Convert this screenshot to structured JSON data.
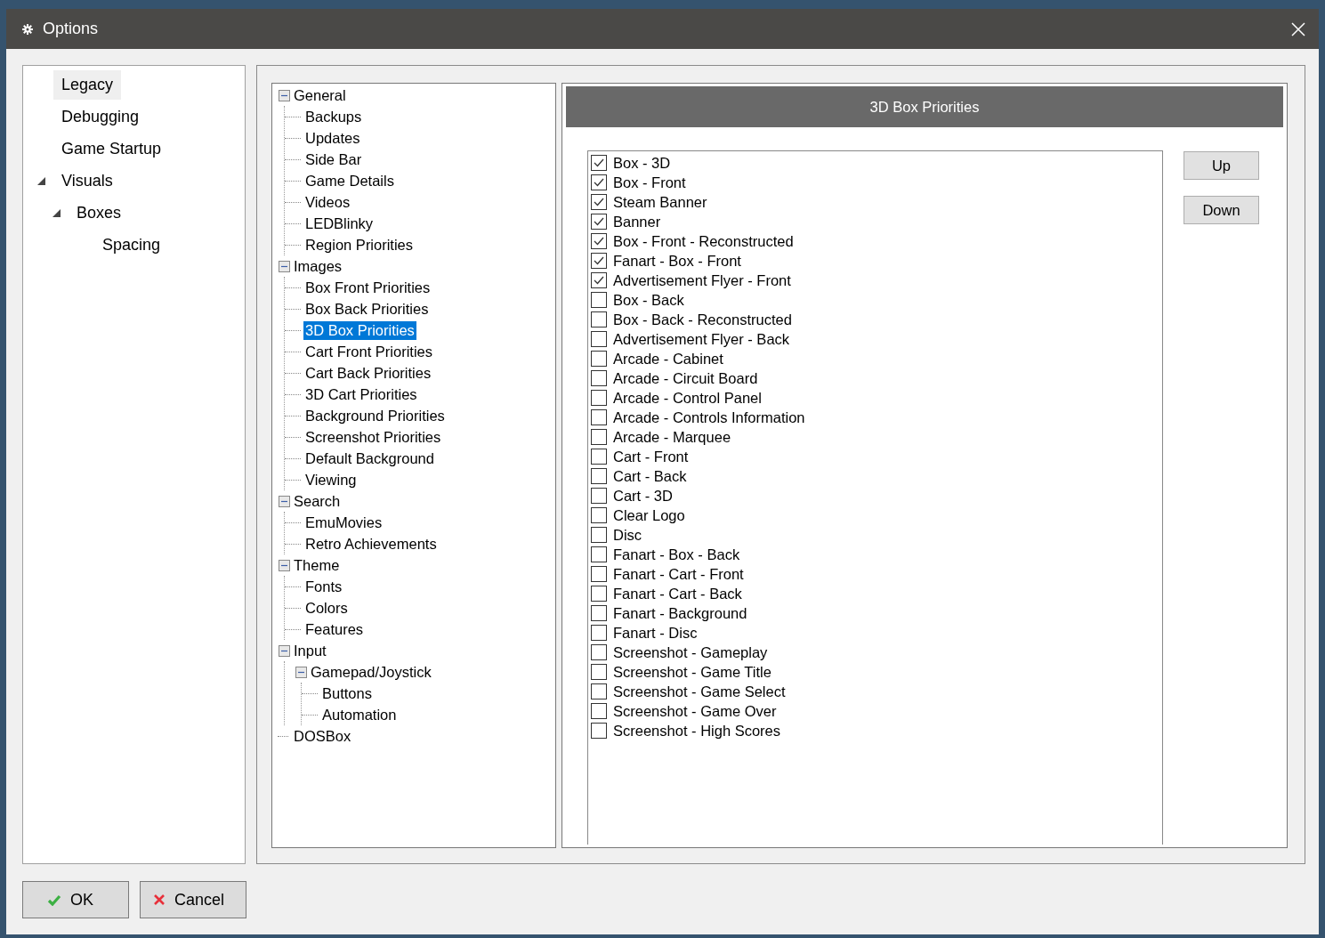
{
  "window": {
    "title": "Options"
  },
  "nav": [
    {
      "label": "Legacy",
      "selected": true
    },
    {
      "label": "Debugging",
      "selected": false
    },
    {
      "label": "Game Startup",
      "selected": false
    },
    {
      "label": "Visuals",
      "selected": false,
      "expanded": true,
      "children": [
        {
          "label": "Boxes",
          "selected": false,
          "expanded": true,
          "children": [
            {
              "label": "Spacing",
              "selected": false
            }
          ]
        }
      ]
    }
  ],
  "tree": [
    {
      "label": "General",
      "selected": false,
      "expanded": true,
      "children": [
        {
          "label": "Backups",
          "selected": false
        },
        {
          "label": "Updates",
          "selected": false
        },
        {
          "label": "Side Bar",
          "selected": false
        },
        {
          "label": "Game Details",
          "selected": false
        },
        {
          "label": "Videos",
          "selected": false
        },
        {
          "label": "LEDBlinky",
          "selected": false
        },
        {
          "label": "Region Priorities",
          "selected": false
        }
      ]
    },
    {
      "label": "Images",
      "selected": false,
      "expanded": true,
      "children": [
        {
          "label": "Box Front Priorities",
          "selected": false
        },
        {
          "label": "Box Back Priorities",
          "selected": false
        },
        {
          "label": "3D Box Priorities",
          "selected": true
        },
        {
          "label": "Cart Front Priorities",
          "selected": false
        },
        {
          "label": "Cart Back Priorities",
          "selected": false
        },
        {
          "label": "3D Cart Priorities",
          "selected": false
        },
        {
          "label": "Background Priorities",
          "selected": false
        },
        {
          "label": "Screenshot Priorities",
          "selected": false
        },
        {
          "label": "Default Background",
          "selected": false
        },
        {
          "label": "Viewing",
          "selected": false
        }
      ]
    },
    {
      "label": "Search",
      "selected": false,
      "expanded": true,
      "children": [
        {
          "label": "EmuMovies",
          "selected": false
        },
        {
          "label": "Retro Achievements",
          "selected": false
        }
      ]
    },
    {
      "label": "Theme",
      "selected": false,
      "expanded": true,
      "children": [
        {
          "label": "Fonts",
          "selected": false
        },
        {
          "label": "Colors",
          "selected": false
        },
        {
          "label": "Features",
          "selected": false
        }
      ]
    },
    {
      "label": "Input",
      "selected": false,
      "expanded": true,
      "children": [
        {
          "label": "Gamepad/Joystick",
          "selected": false,
          "expanded": true,
          "children": [
            {
              "label": "Buttons",
              "selected": false
            },
            {
              "label": "Automation",
              "selected": false
            }
          ]
        }
      ]
    },
    {
      "label": "DOSBox",
      "selected": false
    }
  ],
  "panel": {
    "title": "3D Box Priorities",
    "items": [
      {
        "label": "Box - 3D",
        "checked": true
      },
      {
        "label": "Box - Front",
        "checked": true
      },
      {
        "label": "Steam Banner",
        "checked": true
      },
      {
        "label": "Banner",
        "checked": true
      },
      {
        "label": "Box - Front - Reconstructed",
        "checked": true
      },
      {
        "label": "Fanart - Box - Front",
        "checked": true
      },
      {
        "label": "Advertisement Flyer - Front",
        "checked": true
      },
      {
        "label": "Box - Back",
        "checked": false
      },
      {
        "label": "Box - Back - Reconstructed",
        "checked": false
      },
      {
        "label": "Advertisement Flyer - Back",
        "checked": false
      },
      {
        "label": "Arcade - Cabinet",
        "checked": false
      },
      {
        "label": "Arcade - Circuit Board",
        "checked": false
      },
      {
        "label": "Arcade - Control Panel",
        "checked": false
      },
      {
        "label": "Arcade - Controls Information",
        "checked": false
      },
      {
        "label": "Arcade - Marquee",
        "checked": false
      },
      {
        "label": "Cart - Front",
        "checked": false
      },
      {
        "label": "Cart - Back",
        "checked": false
      },
      {
        "label": "Cart - 3D",
        "checked": false
      },
      {
        "label": "Clear Logo",
        "checked": false
      },
      {
        "label": "Disc",
        "checked": false
      },
      {
        "label": "Fanart - Box - Back",
        "checked": false
      },
      {
        "label": "Fanart - Cart - Front",
        "checked": false
      },
      {
        "label": "Fanart - Cart - Back",
        "checked": false
      },
      {
        "label": "Fanart - Background",
        "checked": false
      },
      {
        "label": "Fanart - Disc",
        "checked": false
      },
      {
        "label": "Screenshot - Gameplay",
        "checked": false
      },
      {
        "label": "Screenshot - Game Title",
        "checked": false
      },
      {
        "label": "Screenshot - Game Select",
        "checked": false
      },
      {
        "label": "Screenshot - Game Over",
        "checked": false
      },
      {
        "label": "Screenshot - High Scores",
        "checked": false
      }
    ],
    "buttons": [
      "Up",
      "Down"
    ]
  },
  "footer": {
    "ok": "OK",
    "cancel": "Cancel"
  }
}
